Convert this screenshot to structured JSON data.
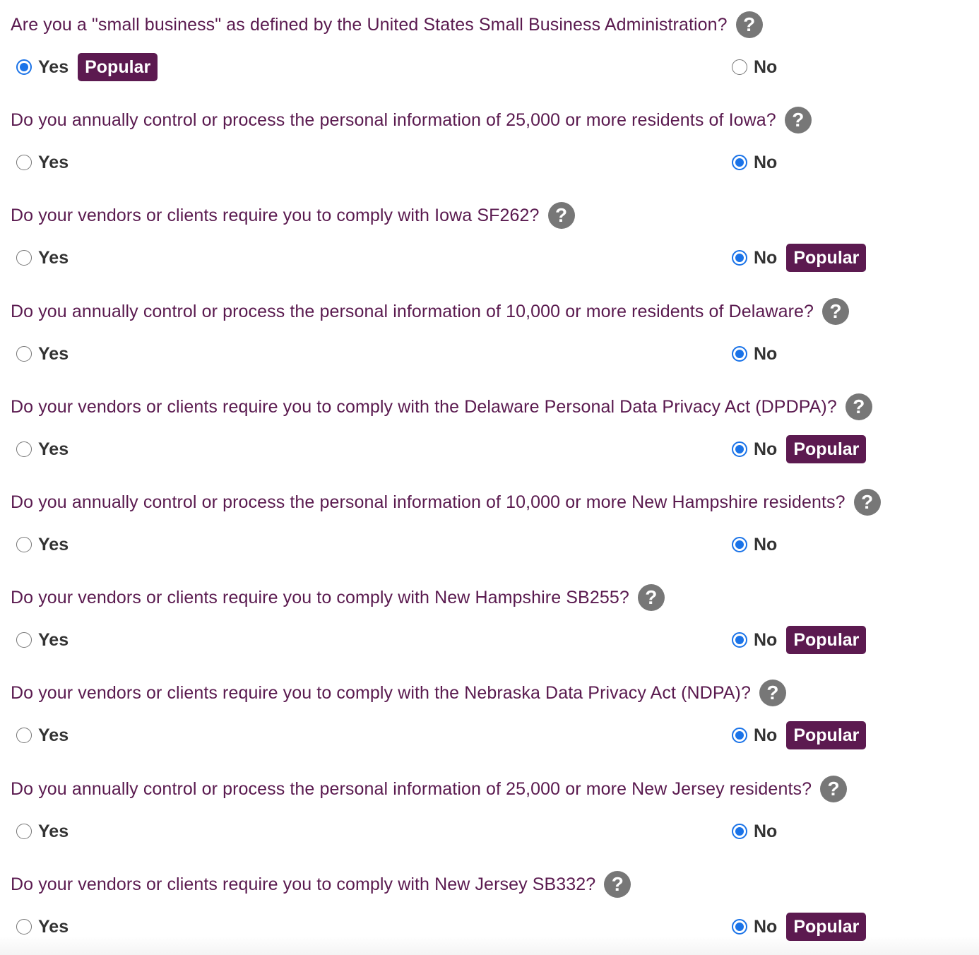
{
  "badge_label": "Popular",
  "help_icon_glyph": "?",
  "colors": {
    "question_text": "#5a1a4f",
    "badge_background": "#5c1a50",
    "radio_selected": "#1a73e8",
    "help_icon_background": "#777777"
  },
  "questions": [
    {
      "text": "Are you a \"small business\" as defined by the United States Small Business Administration?",
      "help_icon": "question-mark-circle-icon",
      "yes_label": "Yes",
      "no_label": "No",
      "selected": "yes",
      "popular_on": "yes"
    },
    {
      "text": "Do you annually control or process the personal information of 25,000 or more residents of Iowa?",
      "help_icon": "question-mark-circle-icon",
      "yes_label": "Yes",
      "no_label": "No",
      "selected": "no",
      "popular_on": null
    },
    {
      "text": "Do your vendors or clients require you to comply with Iowa SF262?",
      "help_icon": "question-mark-circle-icon",
      "yes_label": "Yes",
      "no_label": "No",
      "selected": "no",
      "popular_on": "no"
    },
    {
      "text": "Do you annually control or process the personal information of 10,000 or more residents of Delaware?",
      "help_icon": "question-mark-circle-icon",
      "yes_label": "Yes",
      "no_label": "No",
      "selected": "no",
      "popular_on": null
    },
    {
      "text": "Do your vendors or clients require you to comply with the Delaware Personal Data Privacy Act (DPDPA)?",
      "help_icon": "question-mark-circle-icon",
      "yes_label": "Yes",
      "no_label": "No",
      "selected": "no",
      "popular_on": "no"
    },
    {
      "text": "Do you annually control or process the personal information of 10,000 or more New Hampshire residents?",
      "help_icon": "question-mark-circle-icon",
      "yes_label": "Yes",
      "no_label": "No",
      "selected": "no",
      "popular_on": null
    },
    {
      "text": "Do your vendors or clients require you to comply with New Hampshire SB255?",
      "help_icon": "question-mark-circle-icon",
      "yes_label": "Yes",
      "no_label": "No",
      "selected": "no",
      "popular_on": "no"
    },
    {
      "text": "Do your vendors or clients require you to comply with the Nebraska Data Privacy Act (NDPA)?",
      "help_icon": "question-mark-circle-icon",
      "yes_label": "Yes",
      "no_label": "No",
      "selected": "no",
      "popular_on": "no"
    },
    {
      "text": "Do you annually control or process the personal information of 25,000 or more New Jersey residents?",
      "help_icon": "question-mark-circle-icon",
      "yes_label": "Yes",
      "no_label": "No",
      "selected": "no",
      "popular_on": null
    },
    {
      "text": "Do your vendors or clients require you to comply with New Jersey SB332?",
      "help_icon": "question-mark-circle-icon",
      "yes_label": "Yes",
      "no_label": "No",
      "selected": "no",
      "popular_on": "no"
    }
  ]
}
